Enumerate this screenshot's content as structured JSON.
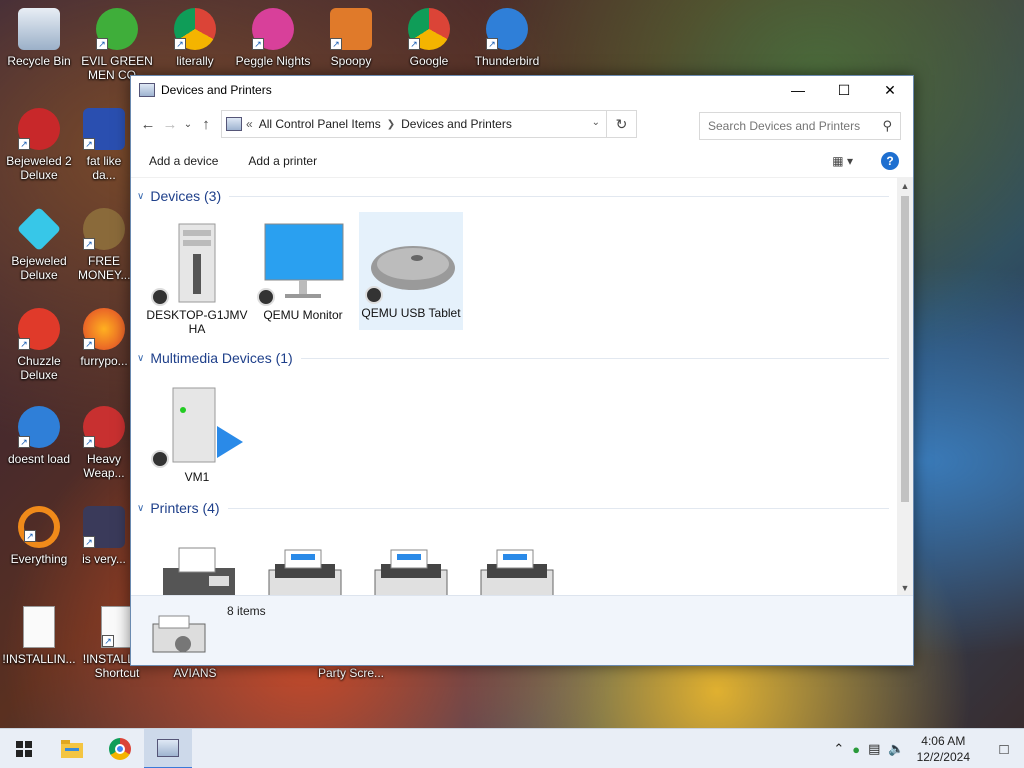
{
  "desktop": {
    "icons": [
      {
        "label": "Recycle Bin"
      },
      {
        "label": "EVIL GREEN MEN CO..."
      },
      {
        "label": "literally"
      },
      {
        "label": "Peggle Nights"
      },
      {
        "label": "Spoopy"
      },
      {
        "label": "Google"
      },
      {
        "label": "Thunderbird"
      },
      {
        "label": "Bejeweled 2 Deluxe"
      },
      {
        "label": "fat like da..."
      },
      {
        "label": "Bejeweled Deluxe"
      },
      {
        "label": "FREE MONEY..."
      },
      {
        "label": "Chuzzle Deluxe"
      },
      {
        "label": "furrypo..."
      },
      {
        "label": "doesnt load"
      },
      {
        "label": "Heavy Weap..."
      },
      {
        "label": "Everything"
      },
      {
        "label": "is very..."
      },
      {
        "label": "!INSTALLIN..."
      },
      {
        "label": "!INSTALL... - Shortcut"
      },
      {
        "label": "AVIANS"
      },
      {
        "label": "Party Scre..."
      }
    ]
  },
  "window": {
    "title": "Devices and Printers",
    "address": {
      "crumb_prefix": "«",
      "crumbs": [
        "All Control Panel Items",
        "Devices and Printers"
      ]
    },
    "search": {
      "placeholder": "Search Devices and Printers"
    },
    "commands": {
      "add_device": "Add a device",
      "add_printer": "Add a printer",
      "help": "?"
    },
    "groups": {
      "devices": {
        "title": "Devices (3)",
        "items": [
          {
            "label": "DESKTOP-G1JMVHA"
          },
          {
            "label": "QEMU Monitor"
          },
          {
            "label": "QEMU USB Tablet"
          }
        ]
      },
      "multimedia": {
        "title": "Multimedia Devices (1)",
        "items": [
          {
            "label": "VM1"
          }
        ]
      },
      "printers": {
        "title": "Printers (4)",
        "items": [
          {
            "label": ""
          },
          {
            "label": ""
          },
          {
            "label": ""
          },
          {
            "label": ""
          }
        ]
      }
    },
    "footer": {
      "count": "8 items"
    }
  },
  "taskbar": {
    "clock": {
      "time": "4:06 AM",
      "date": "12/2/2024"
    }
  },
  "colors": {
    "accent": "#1e6fd0",
    "group_title": "#1e3f8a",
    "selection": "#e5f1fb"
  }
}
